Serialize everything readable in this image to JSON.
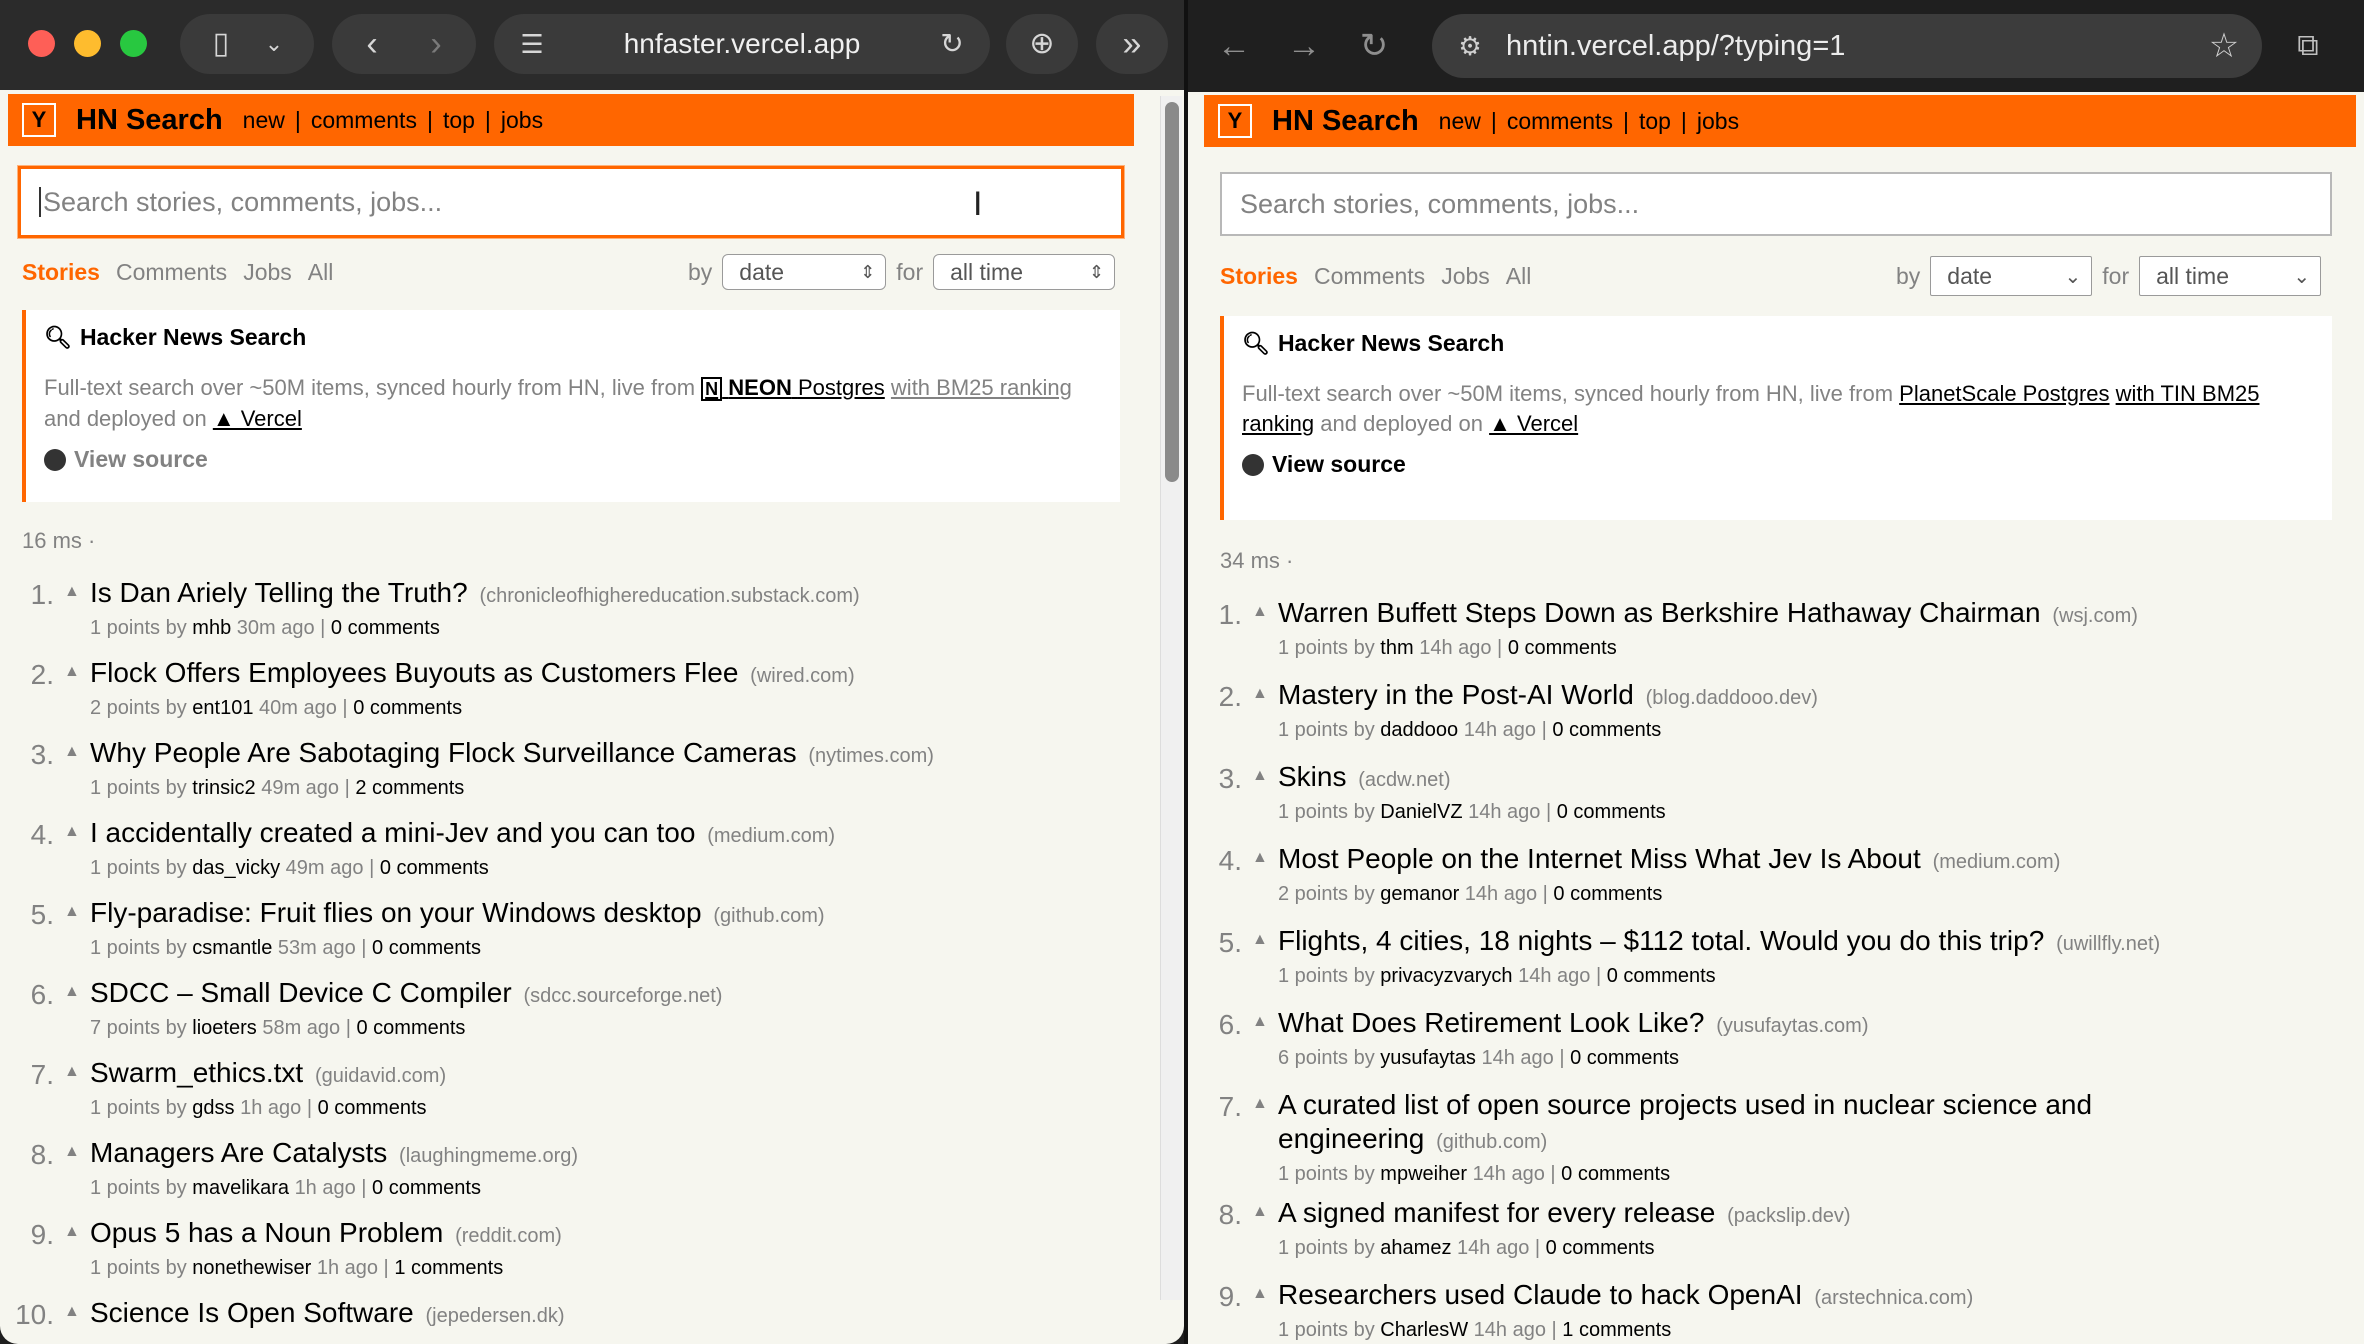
{
  "left": {
    "browser": {
      "url": "hnfaster.vercel.app"
    },
    "header": {
      "logo": "Y",
      "title": "HN Search",
      "nav": [
        "new",
        "comments",
        "top",
        "jobs"
      ]
    },
    "search": {
      "placeholder": "Search stories, comments, jobs..."
    },
    "tabs": [
      "Stories",
      "Comments",
      "Jobs",
      "All"
    ],
    "filter": {
      "by_label": "by",
      "by_value": "date",
      "for_label": "for",
      "for_value": "all time"
    },
    "card": {
      "title": "Hacker News Search",
      "desc_prefix": "Full-text search over ~50M items, synced hourly from HN, live from",
      "db_logo": "NEON",
      "db_name": "Postgres",
      "ranking": "with BM25 ranking",
      "deployed": "and deployed on",
      "host": "▲ Vercel",
      "source": "View source"
    },
    "timing": "16 ms ·",
    "stories": [
      {
        "rank": "1.",
        "title": "Is Dan Ariely Telling the Truth?",
        "domain": "(chronicleofhighereducation.substack.com)",
        "points": "1 points by",
        "user": "mhb",
        "age": "30m ago",
        "comments": "0 comments"
      },
      {
        "rank": "2.",
        "title": "Flock Offers Employees Buyouts as Customers Flee",
        "domain": "(wired.com)",
        "points": "2 points by",
        "user": "ent101",
        "age": "40m ago",
        "comments": "0 comments"
      },
      {
        "rank": "3.",
        "title": "Why People Are Sabotaging Flock Surveillance Cameras",
        "domain": "(nytimes.com)",
        "points": "1 points by",
        "user": "trinsic2",
        "age": "49m ago",
        "comments": "2 comments"
      },
      {
        "rank": "4.",
        "title": "I accidentally created a mini-Jev and you can too",
        "domain": "(medium.com)",
        "points": "1 points by",
        "user": "das_vicky",
        "age": "49m ago",
        "comments": "0 comments"
      },
      {
        "rank": "5.",
        "title": "Fly-paradise: Fruit flies on your Windows desktop",
        "domain": "(github.com)",
        "points": "1 points by",
        "user": "csmantle",
        "age": "53m ago",
        "comments": "0 comments"
      },
      {
        "rank": "6.",
        "title": "SDCC – Small Device C Compiler",
        "domain": "(sdcc.sourceforge.net)",
        "points": "7 points by",
        "user": "lioeters",
        "age": "58m ago",
        "comments": "0 comments"
      },
      {
        "rank": "7.",
        "title": "Swarm_ethics.txt",
        "domain": "(guidavid.com)",
        "points": "1 points by",
        "user": "gdss",
        "age": "1h ago",
        "comments": "0 comments"
      },
      {
        "rank": "8.",
        "title": "Managers Are Catalysts",
        "domain": "(laughingmeme.org)",
        "points": "1 points by",
        "user": "mavelikara",
        "age": "1h ago",
        "comments": "0 comments"
      },
      {
        "rank": "9.",
        "title": "Opus 5 has a Noun Problem",
        "domain": "(reddit.com)",
        "points": "1 points by",
        "user": "nonethewiser",
        "age": "1h ago",
        "comments": "1 comments"
      },
      {
        "rank": "10.",
        "title": "Science Is Open Software",
        "domain": "(jepedersen.dk)",
        "points": "",
        "user": "",
        "age": "",
        "comments": ""
      }
    ]
  },
  "right": {
    "browser": {
      "url": "hntin.vercel.app/?typing=1"
    },
    "header": {
      "logo": "Y",
      "title": "HN Search",
      "nav": [
        "new",
        "comments",
        "top",
        "jobs"
      ]
    },
    "search": {
      "placeholder": "Search stories, comments, jobs..."
    },
    "tabs": [
      "Stories",
      "Comments",
      "Jobs",
      "All"
    ],
    "filter": {
      "by_label": "by",
      "by_value": "date",
      "for_label": "for",
      "for_value": "all time"
    },
    "card": {
      "title": "Hacker News Search",
      "desc_prefix": "Full-text search over ~50M items, synced hourly from HN, live from",
      "db_name": "PlanetScale Postgres",
      "ranking": "with TIN BM25 ranking",
      "deployed": "and deployed on",
      "host": "▲ Vercel",
      "source": "View source"
    },
    "timing": "34 ms ·",
    "stories": [
      {
        "rank": "1.",
        "title": "Warren Buffett Steps Down as Berkshire Hathaway Chairman",
        "domain": "(wsj.com)",
        "points": "1 points by",
        "user": "thm",
        "age": "14h ago",
        "comments": "0 comments"
      },
      {
        "rank": "2.",
        "title": "Mastery in the Post-AI World",
        "domain": "(blog.daddooo.dev)",
        "points": "1 points by",
        "user": "daddooo",
        "age": "14h ago",
        "comments": "0 comments"
      },
      {
        "rank": "3.",
        "title": "Skins",
        "domain": "(acdw.net)",
        "points": "1 points by",
        "user": "DanielVZ",
        "age": "14h ago",
        "comments": "0 comments"
      },
      {
        "rank": "4.",
        "title": "Most People on the Internet Miss What Jev Is About",
        "domain": "(medium.com)",
        "points": "2 points by",
        "user": "gemanor",
        "age": "14h ago",
        "comments": "0 comments"
      },
      {
        "rank": "5.",
        "title": "Flights, 4 cities, 18 nights – $112 total. Would you do this trip?",
        "domain": "(uwillfly.net)",
        "points": "1 points by",
        "user": "privacyzvarych",
        "age": "14h ago",
        "comments": "0 comments"
      },
      {
        "rank": "6.",
        "title": "What Does Retirement Look Like?",
        "domain": "(yusufaytas.com)",
        "points": "6 points by",
        "user": "yusufaytas",
        "age": "14h ago",
        "comments": "0 comments"
      },
      {
        "rank": "7.",
        "title": "A curated list of open source projects used in nuclear science and",
        "title2": "engineering",
        "domain": "(github.com)",
        "points": "1 points by",
        "user": "mpweiher",
        "age": "14h ago",
        "comments": "0 comments"
      },
      {
        "rank": "8.",
        "title": "A signed manifest for every release",
        "domain": "(packslip.dev)",
        "points": "1 points by",
        "user": "ahamez",
        "age": "14h ago",
        "comments": "0 comments"
      },
      {
        "rank": "9.",
        "title": "Researchers used Claude to hack OpenAI",
        "domain": "(arstechnica.com)",
        "points": "1 points by",
        "user": "CharlesW",
        "age": "14h ago",
        "comments": "1 comments"
      }
    ]
  }
}
